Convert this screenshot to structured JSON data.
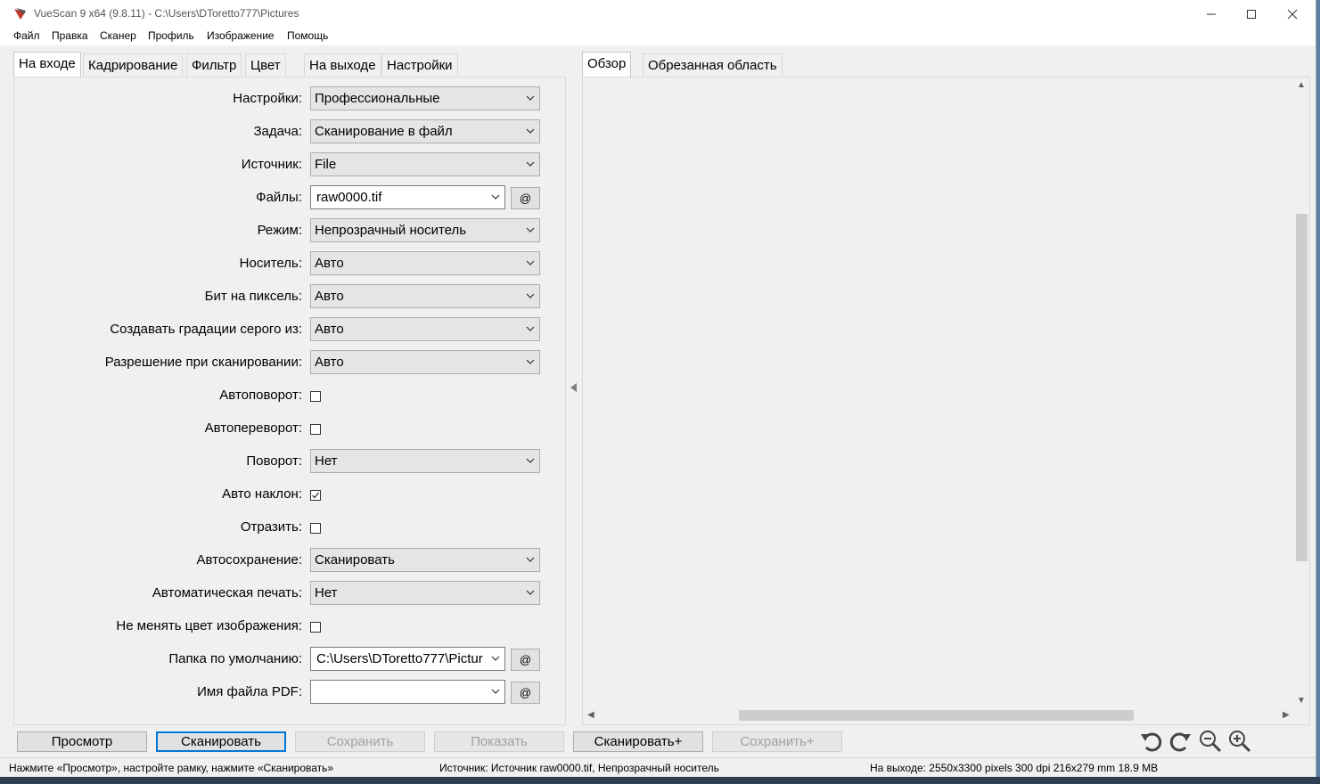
{
  "window": {
    "title": "VueScan 9 x64 (9.8.11) - C:\\Users\\DToretto777\\Pictures"
  },
  "menu": [
    "Файл",
    "Правка",
    "Сканер",
    "Профиль",
    "Изображение",
    "Помощь"
  ],
  "left_tabs": [
    "На входе",
    "Кадрирование",
    "Фильтр",
    "Цвет",
    "На выходе",
    "Настройки"
  ],
  "right_tabs": [
    "Обзор",
    "Обрезанная область"
  ],
  "form": {
    "settings": {
      "label": "Настройки:",
      "value": "Профессиональные"
    },
    "task": {
      "label": "Задача:",
      "value": "Сканирование в файл"
    },
    "source": {
      "label": "Источник:",
      "value": "File"
    },
    "files": {
      "label": "Файлы:",
      "value": "raw0000.tif",
      "at": "@"
    },
    "mode": {
      "label": "Режим:",
      "value": "Непрозрачный носитель"
    },
    "media": {
      "label": "Носитель:",
      "value": "Авто"
    },
    "bits": {
      "label": "Бит на пиксель:",
      "value": "Авто"
    },
    "grayscale": {
      "label": "Создавать градации серого из:",
      "value": "Авто"
    },
    "resolution": {
      "label": "Разрешение при сканировании:",
      "value": "Авто"
    },
    "auto_rotate": {
      "label": "Автоповорот:",
      "checked": false
    },
    "auto_flip": {
      "label": "Автопереворот:",
      "checked": false
    },
    "rotation": {
      "label": "Поворот:",
      "value": "Нет"
    },
    "auto_skew": {
      "label": "Авто наклон:",
      "checked": true
    },
    "mirror": {
      "label": "Отразить:",
      "checked": false
    },
    "auto_save": {
      "label": "Автосохранение:",
      "value": "Сканировать"
    },
    "auto_print": {
      "label": "Автоматическая печать:",
      "value": "Нет"
    },
    "keep_color": {
      "label": "Не менять цвет изображения:",
      "checked": false
    },
    "default_folder": {
      "label": "Папка по умолчанию:",
      "value": "C:\\Users\\DToretto777\\Pictur",
      "at": "@"
    },
    "pdf_name": {
      "label": "Имя файла PDF:",
      "value": "",
      "at": "@"
    }
  },
  "buttons": {
    "preview": "Просмотр",
    "scan": "Сканировать",
    "save": "Сохранить",
    "show": "Показать",
    "scan_plus": "Сканировать+",
    "save_plus": "Сохранить+"
  },
  "status": {
    "hint": "Нажмите «Просмотр», настройте рамку, нажмите «Сканировать»",
    "source": "Источник: Источник raw0000.tif, Непрозрачный носитель",
    "output": "На выходе: 2550x3300 pixels 300 dpi 216x279 mm 18.9 MB"
  },
  "colors": {
    "accent": "#0078d7",
    "window_bg": "#f0f0f0",
    "disabled_text": "#a0a0a0"
  },
  "icons": [
    "vuescan-app-icon",
    "minimize-icon",
    "maximize-icon",
    "close-icon",
    "chevron-down-icon",
    "checkmark-icon",
    "rotate-left-icon",
    "rotate-right-icon",
    "zoom-out-icon",
    "zoom-in-icon"
  ]
}
